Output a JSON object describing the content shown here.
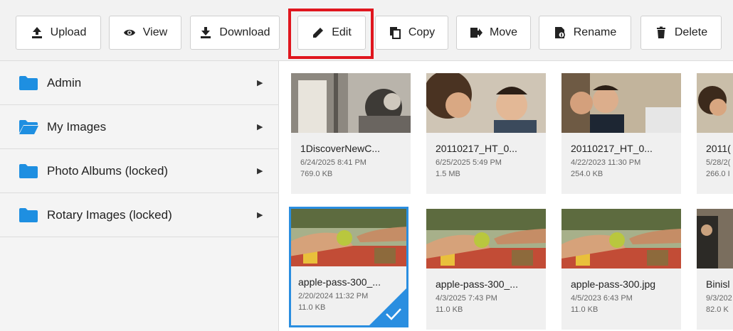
{
  "toolbar": {
    "buttons": [
      {
        "label": "Upload",
        "icon": "upload-icon"
      },
      {
        "label": "View",
        "icon": "eye-icon"
      },
      {
        "label": "Download",
        "icon": "download-icon"
      },
      {
        "label": "Edit",
        "icon": "pencil-icon"
      },
      {
        "label": "Copy",
        "icon": "copy-icon"
      },
      {
        "label": "Move",
        "icon": "move-icon"
      },
      {
        "label": "Rename",
        "icon": "rename-icon"
      },
      {
        "label": "Delete",
        "icon": "trash-icon"
      }
    ],
    "highlighted": "Edit"
  },
  "sidebar": {
    "folders": [
      {
        "label": "Admin",
        "icon": "folder-icon"
      },
      {
        "label": "My Images",
        "icon": "folder-open-icon"
      },
      {
        "label": "Photo Albums (locked)",
        "icon": "folder-icon"
      },
      {
        "label": "Rotary Images (locked)",
        "icon": "folder-icon"
      }
    ],
    "arrow": "▶"
  },
  "files": [
    {
      "name": "1DiscoverNewC...",
      "date": "6/24/2025 8:41 PM",
      "size": "769.0 KB"
    },
    {
      "name": "20110217_HT_0...",
      "date": "6/25/2025 5:49 PM",
      "size": "1.5 MB"
    },
    {
      "name": "20110217_HT_0...",
      "date": "4/22/2023 11:30 PM",
      "size": "254.0 KB"
    },
    {
      "name": "2011(",
      "date": "5/28/2(",
      "size": "266.0 I"
    },
    {
      "name": "apple-pass-300_...",
      "date": "2/20/2024 11:32 PM",
      "size": "11.0 KB",
      "selected": true
    },
    {
      "name": "apple-pass-300_...",
      "date": "4/3/2025 7:43 PM",
      "size": "11.0 KB"
    },
    {
      "name": "apple-pass-300.jpg",
      "date": "4/5/2023 6:43 PM",
      "size": "11.0 KB"
    },
    {
      "name": "Binisl",
      "date": "9/3/202",
      "size": "82.0 K"
    }
  ],
  "colors": {
    "accent": "#2a8ee0",
    "highlight": "#e0161e",
    "folder": "#1e8fe1"
  }
}
